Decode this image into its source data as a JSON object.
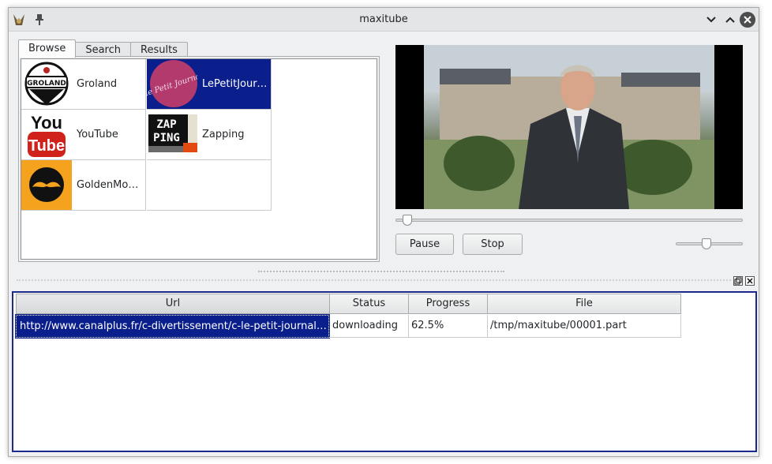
{
  "window": {
    "title": "maxitube"
  },
  "tabs": [
    {
      "label": "Browse",
      "active": true
    },
    {
      "label": "Search",
      "active": false
    },
    {
      "label": "Results",
      "active": false
    }
  ],
  "channels": [
    {
      "label": "Groland",
      "icon": "groland-logo"
    },
    {
      "label": "LePetitJourn...",
      "icon": "lepetitjournal-logo",
      "selected": true
    },
    {
      "label": "YouTube",
      "icon": "youtube-logo"
    },
    {
      "label": "Zapping",
      "icon": "zapping-logo"
    },
    {
      "label": "GoldenMous...",
      "icon": "goldenmoustache-logo"
    }
  ],
  "logos": {
    "groland": "GROLAND",
    "youtube_top": "You",
    "youtube_bottom": "Tube",
    "zapping_top": "ZAP",
    "zapping_bottom": "PING",
    "lepetit": "le Petit Journal"
  },
  "player": {
    "pause_label": "Pause",
    "stop_label": "Stop",
    "position": 0.02,
    "volume": 0.45
  },
  "downloads": {
    "columns": [
      "Url",
      "Status",
      "Progress",
      "File"
    ],
    "rows": [
      {
        "url": "http://www.canalplus.fr/c-divertissement/c-le-petit-journal/pi...",
        "status": "downloading",
        "progress": "62.5%",
        "file": "/tmp/maxitube/00001.part"
      }
    ]
  },
  "colors": {
    "selection": "#0a1e8c",
    "window_bg": "#eff0f1"
  }
}
